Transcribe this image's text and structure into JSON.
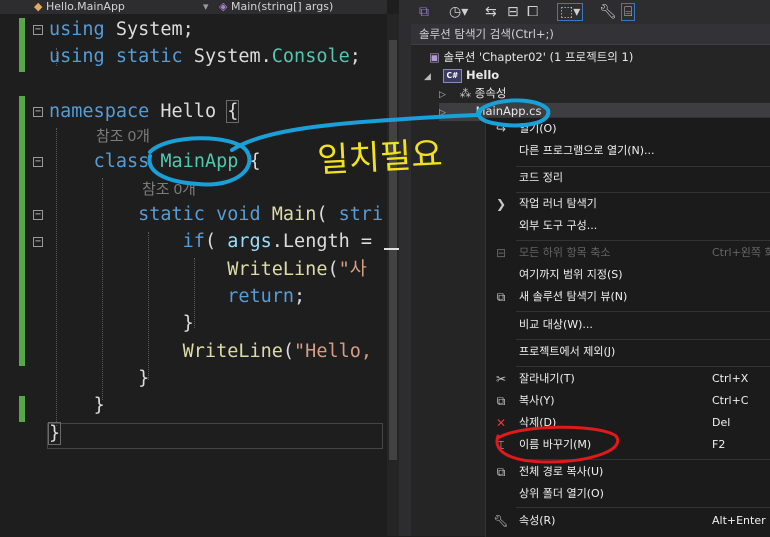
{
  "editor": {
    "nav": {
      "class_name": "Hello.MainApp",
      "member_name": "Main(string[] args)"
    },
    "lines": {
      "l1": [
        "using",
        " System;"
      ],
      "l2": [
        "using",
        " ",
        "static",
        " System.",
        "Console",
        ";"
      ],
      "l4": [
        "namespace",
        " Hello ",
        "{"
      ],
      "l6": [
        "class",
        " ",
        "MainApp",
        " {"
      ],
      "l7": [
        "static",
        " ",
        "void",
        " ",
        "Main",
        "( ",
        "stri"
      ],
      "l8": [
        "if",
        "( ",
        "args",
        ".Length ="
      ],
      "l9": [
        "WriteLine",
        "(",
        "\"사"
      ],
      "l10": [
        "return",
        ";"
      ],
      "l11": "}",
      "l12": [
        "WriteLine",
        "(",
        "\"Hello,"
      ],
      "l13": "}",
      "l14": "}",
      "l15": "}"
    },
    "hints": {
      "class_refs": "참조 0개",
      "method_refs": "참조 0개"
    }
  },
  "solution_explorer": {
    "search_placeholder": "솔루션 탐색기 검색(Ctrl+;)",
    "solution_label": "솔루션 'Chapter02' (1 프로젝트의 1)",
    "project": "Hello",
    "project_badge": "C#",
    "dependencies": "종속성",
    "file": "MainApp.cs"
  },
  "menu": {
    "open": "열기(O)",
    "open_with": "다른 프로그램으로 열기(N)...",
    "cleanup": "코드 정리",
    "task_runner": "작업 러너 탐색기",
    "external_tools": "외부 도구 구성...",
    "collapse_all": {
      "label": "모든 하위 항목 축소",
      "shortcut": "Ctrl+왼쪽 화"
    },
    "scope_here": "여기까지 범위 지정(S)",
    "new_view": "새 솔루션 탐색기 뷰(N)",
    "compare": "비교 대상(W)...",
    "exclude": "프로젝트에서 제외(J)",
    "cut": {
      "label": "잘라내기(T)",
      "shortcut": "Ctrl+X"
    },
    "copy": {
      "label": "복사(Y)",
      "shortcut": "Ctrl+C"
    },
    "delete": {
      "label": "삭제(D)",
      "shortcut": "Del"
    },
    "rename": {
      "label": "이름 바꾸기(M)",
      "shortcut": "F2"
    },
    "copy_path": "전체 경로 복사(U)",
    "open_folder": "상위 폴더 열기(O)",
    "properties": {
      "label": "속성(R)",
      "shortcut": "Alt+Enter"
    }
  },
  "annotation": {
    "note": "일치필요"
  },
  "colors": {
    "keyword": "#569cd6",
    "type": "#4ec9b0",
    "string": "#d69d85",
    "method": "#dcdcaa",
    "annotation_blue": "#1aa0d8",
    "annotation_red": "#e01a1a",
    "annotation_yellow": "#f2e21c"
  }
}
